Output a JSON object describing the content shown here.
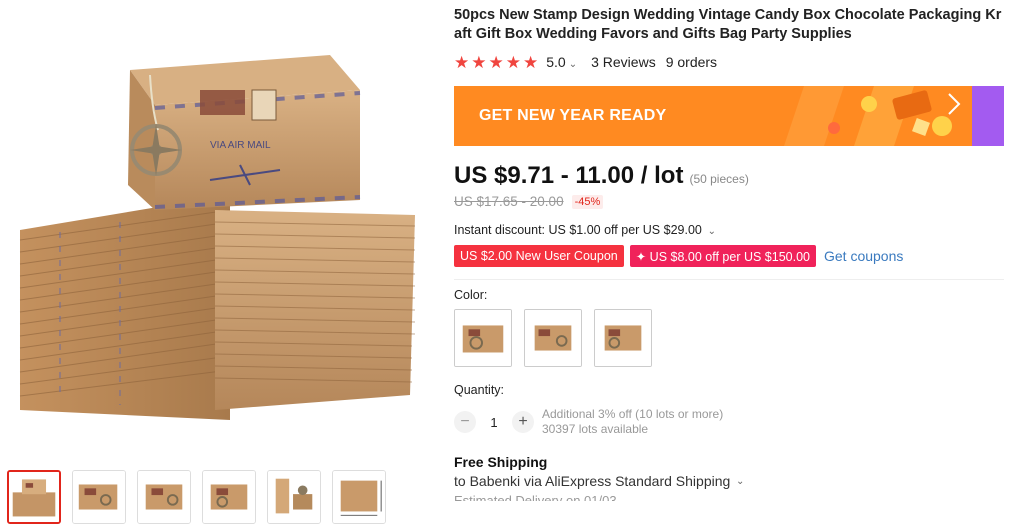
{
  "product": {
    "title": "50pcs New Stamp Design Wedding Vintage Candy Box Chocolate Packaging Kraft Gift Box Wedding Favors and Gifts Bag Party Supplies",
    "image_text": "VIA AIR MAIL"
  },
  "rating": {
    "stars": 5,
    "value": "5.0",
    "reviews": "3 Reviews",
    "orders": "9 orders"
  },
  "banner": {
    "text": "GET NEW YEAR READY",
    "color": "#ff8a21"
  },
  "price": {
    "current": "US $9.71 - 11.00 / lot",
    "pieces": "(50 pieces)",
    "original": "US $17.65 - 20.00",
    "discount": "-45%"
  },
  "instant_discount": "Instant discount: US $1.00 off per US $29.00",
  "coupons": {
    "new_user": "US $2.00 New User Coupon",
    "store": "✦ US $8.00 off per US $150.00",
    "get": "Get coupons"
  },
  "color": {
    "label": "Color:",
    "options": [
      "kraft-box-1",
      "kraft-box-2",
      "kraft-box-3"
    ]
  },
  "quantity": {
    "label": "Quantity:",
    "value": "1",
    "minus": "−",
    "plus": "+",
    "note1": "Additional 3% off (10 lots or more)",
    "note2": "30397 lots available"
  },
  "shipping": {
    "title": "Free Shipping",
    "to": "to Babenki via AliExpress Standard Shipping",
    "estimated": "Estimated Delivery on 01/03"
  },
  "colors": {
    "accent": "#e1251b",
    "kraft": "#c99a6a",
    "link": "#3a7abf"
  }
}
